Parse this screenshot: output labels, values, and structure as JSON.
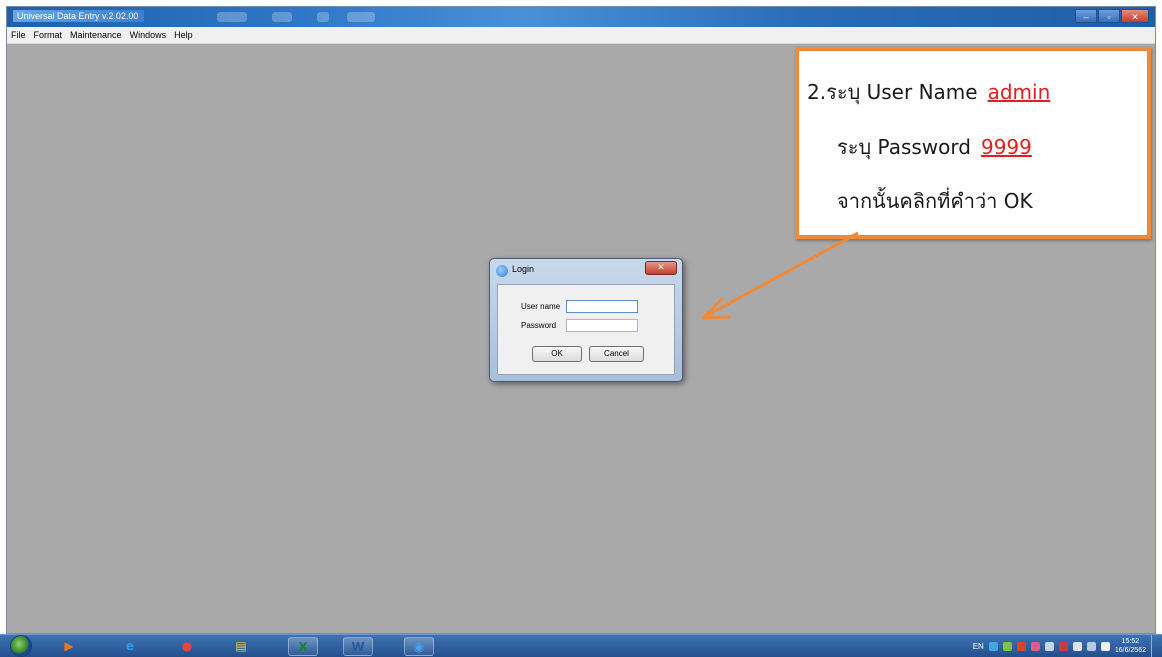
{
  "window": {
    "title": "Universal Data Entry v.2.02.00",
    "caption_buttons": {
      "minimize": "–",
      "maximize": "▫",
      "close": "✕"
    },
    "menu": [
      "File",
      "Format",
      "Maintenance",
      "Windows",
      "Help"
    ]
  },
  "callout": {
    "line1_label": "2.ระบุ User Name",
    "line1_value": "admin",
    "line2_label": "ระบุ Password",
    "line2_value": "9999",
    "line3": "จากนั้นคลิกที่คำว่า OK"
  },
  "login_dialog": {
    "title": "Login",
    "close_glyph": "✕",
    "username_label": "User name",
    "username_value": "",
    "password_label": "Password",
    "password_value": "",
    "ok_label": "OK",
    "cancel_label": "Cancel"
  },
  "taskbar": {
    "apps": [
      {
        "name": "media-player",
        "glyph": "▶",
        "color": "#e87722"
      },
      {
        "name": "internet-explorer",
        "glyph": "e",
        "color": "#2e9be6"
      },
      {
        "name": "chrome",
        "glyph": "●",
        "color": "#e8453c"
      },
      {
        "name": "file-explorer",
        "glyph": "▤",
        "color": "#f2c94c"
      },
      {
        "name": "excel",
        "glyph": "X",
        "color": "#1e7e34"
      },
      {
        "name": "word",
        "glyph": "W",
        "color": "#2b579a"
      },
      {
        "name": "universal-data-entry",
        "glyph": "◉",
        "color": "#4aa3e8"
      }
    ],
    "language": "EN",
    "time": "15:52",
    "date": "16/6/2562"
  },
  "colors": {
    "callout_border": "#ef8a3a",
    "arrow": "#ef8a3a",
    "highlight_text": "#e02020"
  }
}
